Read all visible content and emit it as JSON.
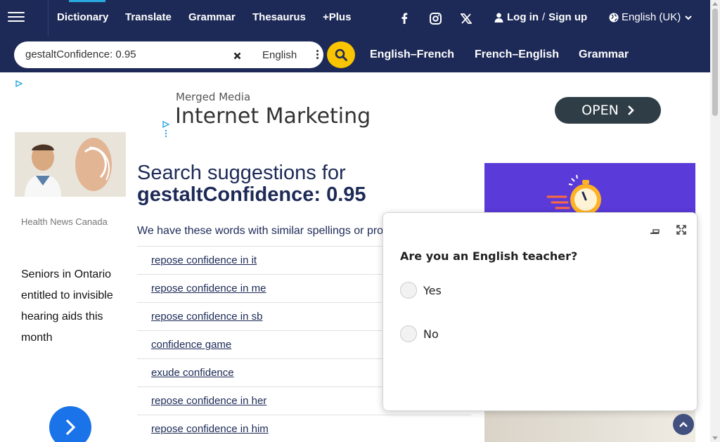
{
  "nav": {
    "items": [
      "Dictionary",
      "Translate",
      "Grammar",
      "Thesaurus",
      "+Plus"
    ],
    "login": "Log in",
    "separator": "/",
    "signup": "Sign up",
    "language": "English (UK)"
  },
  "search": {
    "query": "gestaltConfidence: 0.95",
    "language": "English",
    "tabs": [
      "English–French",
      "French–English",
      "Grammar"
    ]
  },
  "left_ad": {
    "source": "Health News Canada",
    "text": "Seniors in Ontario entitled to invisible hearing aids this month"
  },
  "top_ad": {
    "brand": "Merged Media",
    "headline": "Internet Marketing",
    "button": "OPEN"
  },
  "main": {
    "title_prefix": "Search suggestions for",
    "query": "gestaltConfidence: 0.95",
    "description": "We have these words with similar spellings or pro",
    "suggestions": [
      "repose confidence in it",
      "repose confidence in me",
      "repose confidence in sb",
      "confidence game",
      "exude confidence",
      "repose confidence in her",
      "repose confidence in him"
    ]
  },
  "popup": {
    "question": "Are you an English teacher?",
    "options": [
      "Yes",
      "No"
    ]
  },
  "colors": {
    "nav_bg": "#1d2a57",
    "accent_yellow": "#f9c400",
    "title_blue": "#1d2a57"
  }
}
